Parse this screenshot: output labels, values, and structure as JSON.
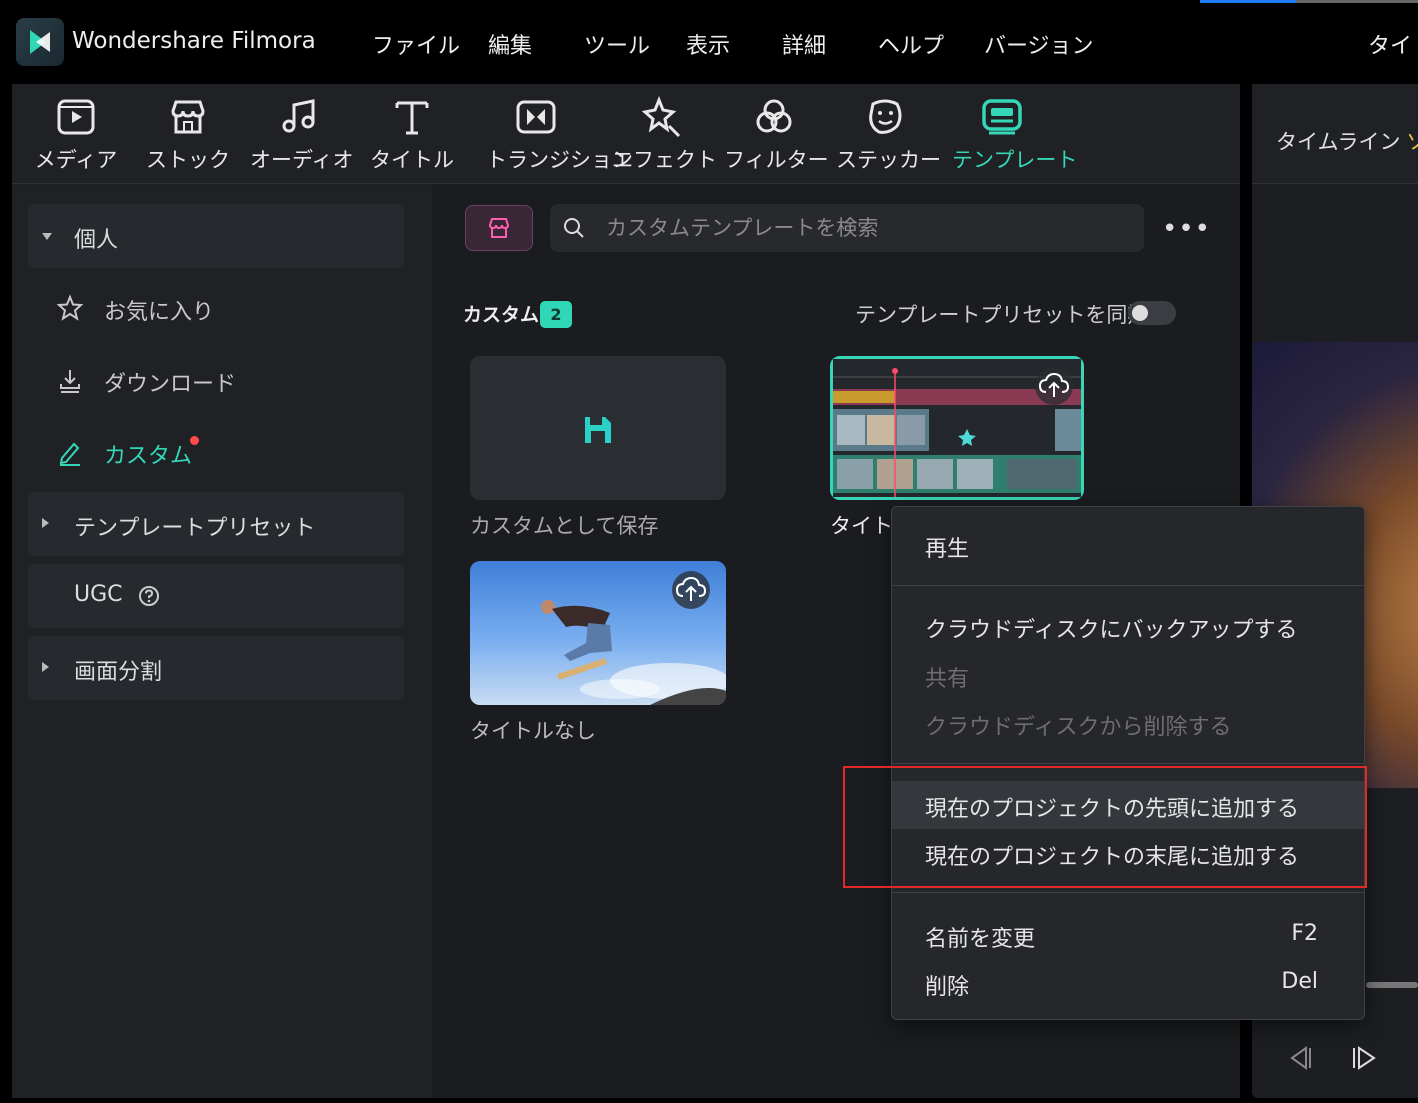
{
  "app": {
    "name": "Wondershare Filmora"
  },
  "menubar": {
    "items": [
      "ファイル",
      "編集",
      "ツール",
      "表示",
      "詳細",
      "ヘルプ",
      "バージョン"
    ],
    "right_cut": "タイト"
  },
  "toolbar": {
    "items": [
      {
        "label": "メディア",
        "icon": "media-icon"
      },
      {
        "label": "ストック",
        "icon": "stock-icon"
      },
      {
        "label": "オーディオ",
        "icon": "audio-icon"
      },
      {
        "label": "タイトル",
        "icon": "title-icon"
      },
      {
        "label": "トランジション",
        "icon": "transition-icon"
      },
      {
        "label": "エフェクト",
        "icon": "effect-icon"
      },
      {
        "label": "フィルター",
        "icon": "filter-icon"
      },
      {
        "label": "ステッカー",
        "icon": "sticker-icon"
      },
      {
        "label": "テンプレート",
        "icon": "template-icon",
        "active": true
      }
    ],
    "accent": "#34d7b8"
  },
  "sidebar": {
    "personal": "個人",
    "favorites": "お気に入り",
    "download": "ダウンロード",
    "custom": "カスタム",
    "template_preset": "テンプレートプリセット",
    "ugc": "UGC",
    "split_screen": "画面分割"
  },
  "search": {
    "placeholder": "カスタムテンプレートを検索"
  },
  "content": {
    "custom_label": "カスタム",
    "custom_count": "2",
    "sync_label": "テンプレートプリセットを同期",
    "sync_enabled": false,
    "cards": [
      {
        "label": "カスタムとして保存"
      },
      {
        "label": "タイトル"
      },
      {
        "label": "タイトルなし"
      }
    ]
  },
  "right_panel": {
    "tab_timeline": "タイムライン",
    "tab_cut": "ソ"
  },
  "context_menu": {
    "play": "再生",
    "backup": "クラウドディスクにバックアップする",
    "share": "共有",
    "delete_cloud": "クラウドディスクから削除する",
    "add_start": "現在のプロジェクトの先頭に追加する",
    "add_end": "現在のプロジェクトの末尾に追加する",
    "rename": "名前を変更",
    "rename_key": "F2",
    "delete": "削除",
    "delete_key": "Del"
  },
  "highlight_color": "#e02a2a"
}
